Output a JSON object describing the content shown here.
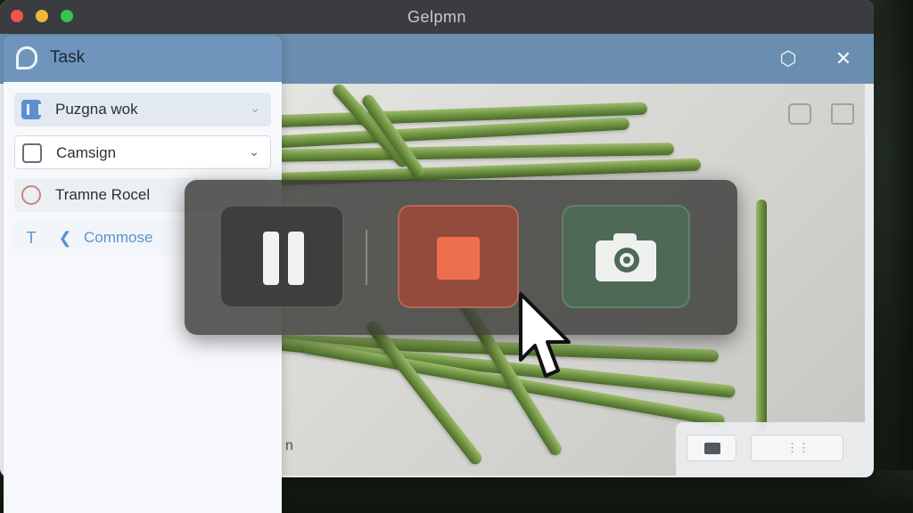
{
  "window": {
    "title": "Gelpmn"
  },
  "sidebar": {
    "header_title": "Task",
    "items": [
      {
        "label": "Puzgna wok",
        "icon": "pause-square-icon"
      },
      {
        "label": "Camsign",
        "icon": "image-icon"
      },
      {
        "label": "Tramne Rocel",
        "icon": "circle-icon"
      },
      {
        "label": "Commose",
        "icon": "text-icon"
      }
    ]
  },
  "header": {
    "icons": [
      "settings-hex-icon",
      "close-icon"
    ]
  },
  "preview": {
    "caption": "n",
    "tools": [
      "monitor-icon",
      "grid-icon"
    ],
    "bottom_button_label": "⋮⋮"
  },
  "recording_controls": {
    "buttons": [
      {
        "name": "pause",
        "icon": "pause-icon"
      },
      {
        "name": "stop",
        "icon": "stop-icon"
      },
      {
        "name": "snapshot",
        "icon": "camera-icon"
      }
    ],
    "colors": {
      "stop_accent": "#ee6f4d",
      "snapshot_bg": "#4e6a56"
    }
  }
}
